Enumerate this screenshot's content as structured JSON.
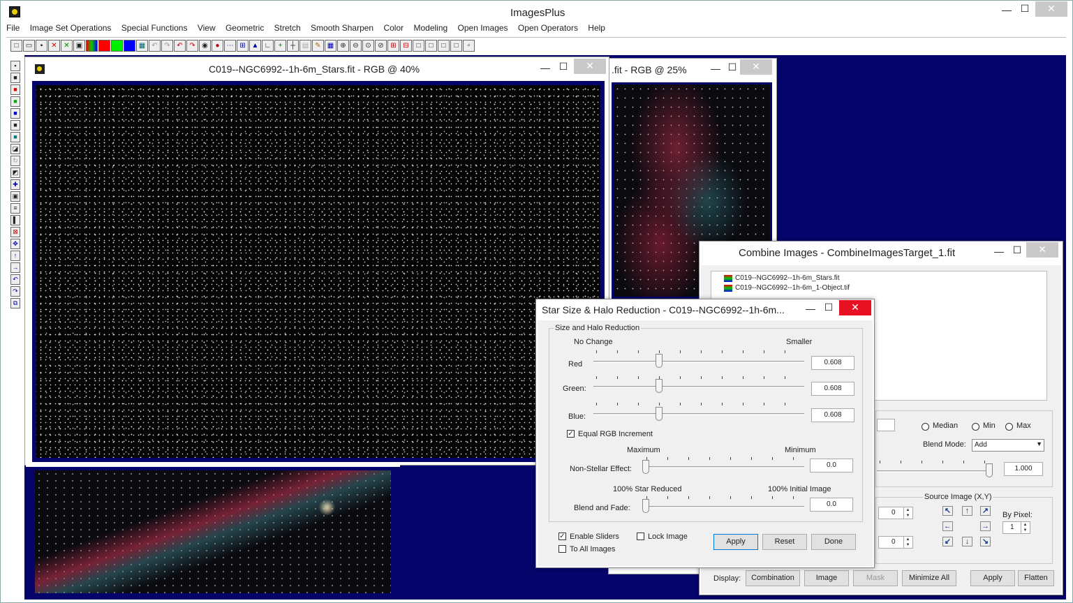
{
  "app": {
    "title": "ImagesPlus",
    "menu": [
      "File",
      "Image Set Operations",
      "Special Functions",
      "View",
      "Geometric",
      "Stretch",
      "Smooth Sharpen",
      "Color",
      "Modeling",
      "Open Images",
      "Open Operators",
      "Help"
    ],
    "window_controls": {
      "minimize": "—",
      "maximize": "☐",
      "close": "✕"
    }
  },
  "toolbar_icons": [
    "new-icon",
    "open-icon",
    "save-icon",
    "close-icon",
    "close-all-icon",
    "copy-icon",
    "rgb-icon",
    "red-channel-icon",
    "green-channel-icon",
    "blue-channel-icon",
    "histogram-icon",
    "undo-icon",
    "redo-icon",
    "undo-all-icon",
    "redo-all-icon",
    "circle-select-icon",
    "circle-fill-icon",
    "dotted-line-icon",
    "zoom-box-icon",
    "levels-icon",
    "curves-icon",
    "crosshair-plus-icon",
    "crosshair-icon",
    "grid-icon",
    "pencil-icon",
    "table-icon",
    "zoom-in-icon",
    "zoom-out-icon",
    "zoom-fit-icon",
    "zoom-100-icon",
    "zoom-plus-icon",
    "zoom-minus-icon",
    "window-icon",
    "window2-icon",
    "window3-icon",
    "window4-icon",
    "window5-icon"
  ],
  "image_windows": {
    "stars_title": "C019--NGC6992--1h-6m_Stars.fit - RGB @ 40%",
    "second_title": ".fit - RGB @ 25%"
  },
  "combine_dialog": {
    "title": "Combine Images - CombineImagesTarget_1.fit",
    "files": [
      "C019--NGC6992--1h-6m_Stars.fit",
      "C019--NGC6992--1h-6m_1-Object.tif"
    ],
    "radios": [
      "Median",
      "Min",
      "Max"
    ],
    "blend_mode_label": "Blend Mode:",
    "blend_mode_value": "Add",
    "slider_value": "1.000",
    "source_image_label": "Source Image (X,Y)",
    "x_value": "0",
    "y_value": "0",
    "by_pixel_label": "By Pixel:",
    "by_pixel_value": "1",
    "display_label": "Display:",
    "buttons": {
      "combination": "Combination",
      "image": "Image",
      "mask": "Mask",
      "minimize_all": "Minimize All",
      "apply": "Apply",
      "flatten": "Flatten"
    }
  },
  "star_dialog": {
    "title": "Star Size & Halo Reduction - C019--NGC6992--1h-6m...",
    "group_title": "Size and Halo Reduction",
    "no_change": "No Change",
    "smaller": "Smaller",
    "red_label": "Red",
    "red_value": "0.608",
    "green_label": "Green:",
    "green_value": "0.608",
    "blue_label": "Blue:",
    "blue_value": "0.608",
    "rgb_fraction": 0.31,
    "equal_rgb": "Equal RGB Increment",
    "maximum": "Maximum",
    "minimum": "Minimum",
    "non_stellar_label": "Non-Stellar Effect:",
    "non_stellar_value": "0.0",
    "star_reduced": "100% Star Reduced",
    "initial_image": "100% Initial Image",
    "blend_label": "Blend and Fade:",
    "blend_value": "0.0",
    "enable_sliders": "Enable Sliders",
    "lock_image": "Lock Image",
    "to_all_images": "To All Images",
    "apply": "Apply",
    "reset": "Reset",
    "done": "Done"
  }
}
